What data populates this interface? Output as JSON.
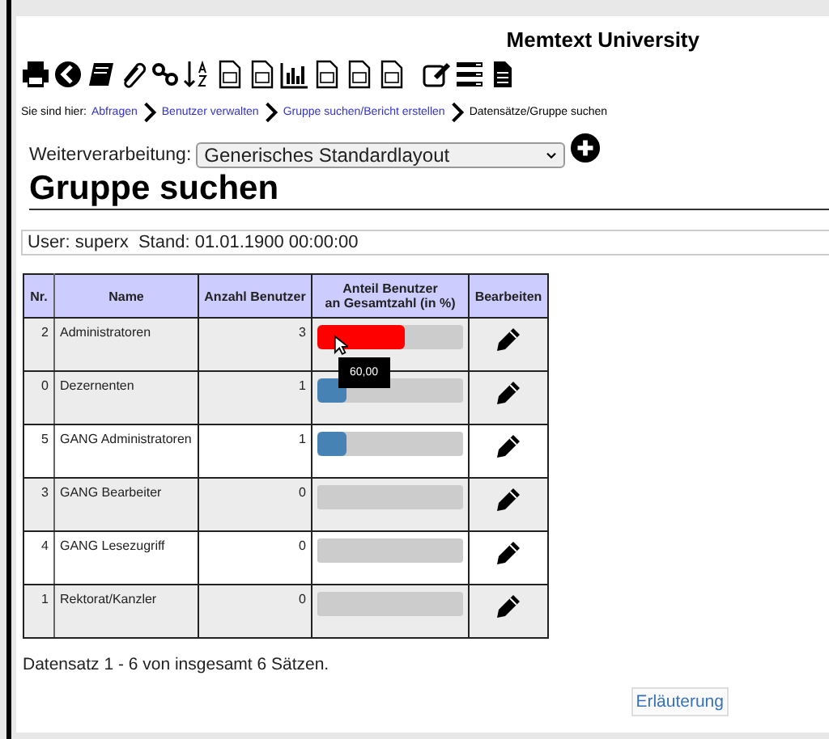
{
  "header": {
    "title": "Memtext University"
  },
  "breadcrumb": {
    "label": "Sie sind hier:",
    "links": [
      "Abfragen",
      "Benutzer verwalten",
      "Gruppe suchen/Bericht erstellen"
    ],
    "current": "Datensätze/Gruppe suchen"
  },
  "processing": {
    "label": "Weiterverarbeitung:",
    "value": "Generisches Standardlayout"
  },
  "heading": "Gruppe suchen",
  "status": "User: superx  Stand: 01.01.1900 00:00:00",
  "table": {
    "columns": [
      "Nr.",
      "Name",
      "Anzahl Benutzer",
      "Anteil Benutzer\nan Gesamtzahl (in %)",
      "Bearbeiten"
    ],
    "rows": [
      {
        "nr": "2",
        "name": "Administratoren",
        "count": "3",
        "level": 0.6,
        "color": "#ff0000",
        "shaded": true,
        "tooltip": "60,00"
      },
      {
        "nr": "0",
        "name": "Dezernenten",
        "count": "1",
        "level": 0.2,
        "color": "#4682b4",
        "shaded": true
      },
      {
        "nr": "5",
        "name": "GANG Administratoren",
        "count": "1",
        "level": 0.2,
        "color": "#4682b4",
        "shaded": false
      },
      {
        "nr": "3",
        "name": "GANG Bearbeiter",
        "count": "0",
        "level": 0,
        "shaded": true
      },
      {
        "nr": "4",
        "name": "GANG Lesezugriff",
        "count": "0",
        "level": 0,
        "shaded": false
      },
      {
        "nr": "1",
        "name": "Rektorat/Kanzler",
        "count": "0",
        "level": 0,
        "shaded": true
      }
    ]
  },
  "footer": "Datensatz 1 - 6 von insgesamt 6 Sätzen.",
  "help_button": "Erläuterung"
}
